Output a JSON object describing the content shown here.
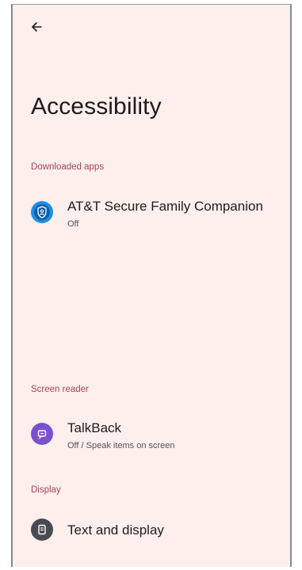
{
  "header": {
    "back_icon": "arrow-back-icon",
    "title": "Accessibility"
  },
  "sections": {
    "downloaded_apps": {
      "header": "Downloaded apps",
      "items": [
        {
          "title": "AT&T Secure Family Companion",
          "subtitle": "Off",
          "icon": "shield-person-icon",
          "icon_color": "#1e8ee3"
        }
      ]
    },
    "screen_reader": {
      "header": "Screen reader",
      "items": [
        {
          "title": "TalkBack",
          "subtitle": "Off / Speak items on screen",
          "icon": "talkback-icon",
          "icon_color": "#7b4fd1"
        }
      ]
    },
    "display": {
      "header": "Display",
      "items": [
        {
          "title": "Text and display",
          "icon": "text-display-icon",
          "icon_color": "#4a4a52"
        }
      ]
    }
  },
  "colors": {
    "background": "#fcefec",
    "section_header": "#a4445a",
    "text_primary": "#1f1b1b"
  }
}
